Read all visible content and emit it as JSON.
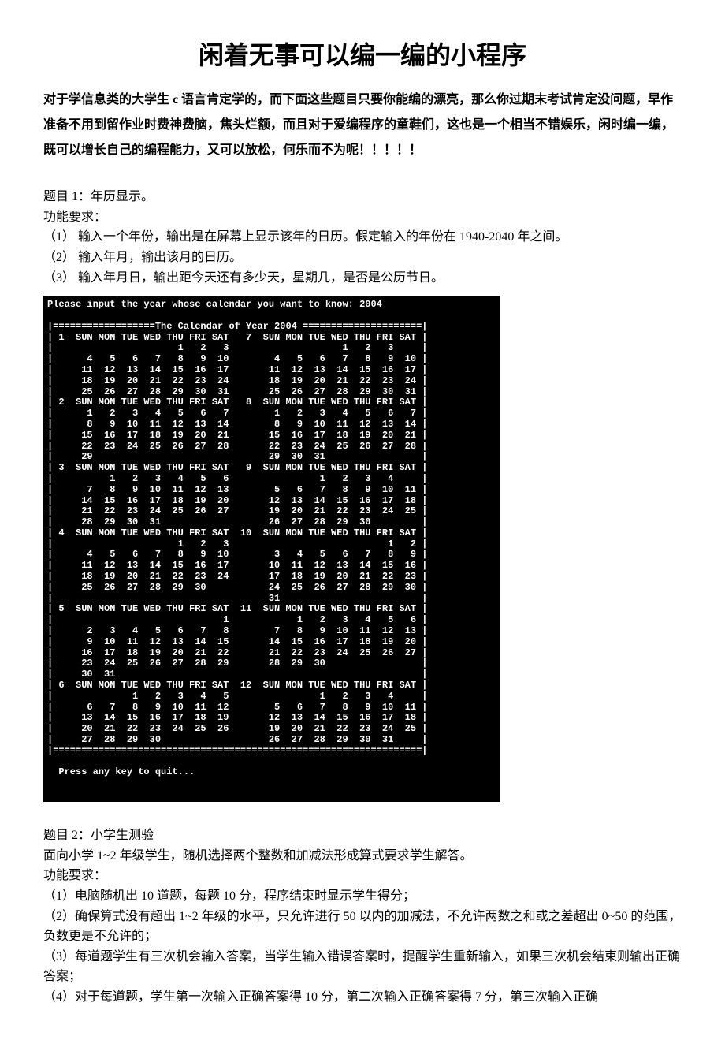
{
  "title": "闲着无事可以编一编的小程序",
  "intro": "对于学信息类的大学生 c 语言肯定学的，而下面这些题目只要你能编的漂亮，那么你过期末考试肯定没问题，早作准备不用到留作业时费神费脑，焦头烂额，而且对于爱编程序的童鞋们，这也是一个相当不错娱乐，闲时编一编，既可以增长自己的编程能力，又可以放松，何乐而不为呢！！！！！",
  "problem1": {
    "title": "题目 1：年历显示。",
    "req_label": "功能要求：",
    "items": [
      "（1）  输入一个年份，输出是在屏幕上显示该年的日历。假定输入的年份在 1940-2040 年之间。",
      "（2）  输入年月，输出该月的日历。",
      "（3）  输入年月日，输出距今天还有多少天，星期几，是否是公历节日。"
    ]
  },
  "console": "Please input the year whose calendar you want to know: 2004\n\n|==================The Calendar of Year 2004 =====================|\n| 1  SUN MON TUE WED THU FRI SAT   7  SUN MON TUE WED THU FRI SAT |\n|                      1   2   3                    1   2   3     |\n|      4   5   6   7   8   9  10        4   5   6   7   8   9  10 |\n|     11  12  13  14  15  16  17       11  12  13  14  15  16  17 |\n|     18  19  20  21  22  23  24       18  19  20  21  22  23  24 |\n|     25  26  27  28  29  30  31       25  26  27  28  29  30  31 |\n| 2  SUN MON TUE WED THU FRI SAT   8  SUN MON TUE WED THU FRI SAT |\n|      1   2   3   4   5   6   7        1   2   3   4   5   6   7 |\n|      8   9  10  11  12  13  14        8   9  10  11  12  13  14 |\n|     15  16  17  18  19  20  21       15  16  17  18  19  20  21 |\n|     22  23  24  25  26  27  28       22  23  24  25  26  27  28 |\n|     29                               29  30  31                 |\n| 3  SUN MON TUE WED THU FRI SAT   9  SUN MON TUE WED THU FRI SAT |\n|          1   2   3   4   5   6                1   2   3   4     |\n|      7   8   9  10  11  12  13        5   6   7   8   9  10  11 |\n|     14  15  16  17  18  19  20       12  13  14  15  16  17  18 |\n|     21  22  23  24  25  26  27       19  20  21  22  23  24  25 |\n|     28  29  30  31                   26  27  28  29  30         |\n| 4  SUN MON TUE WED THU FRI SAT  10  SUN MON TUE WED THU FRI SAT |\n|                      1   2   3                            1   2 |\n|      4   5   6   7   8   9  10        3   4   5   6   7   8   9 |\n|     11  12  13  14  15  16  17       10  11  12  13  14  15  16 |\n|     18  19  20  21  22  23  24       17  18  19  20  21  22  23 |\n|     25  26  27  28  29  30           24  25  26  27  28  29  30 |\n|                                      31                         |\n| 5  SUN MON TUE WED THU FRI SAT  11  SUN MON TUE WED THU FRI SAT |\n|                              1            1   2   3   4   5   6 |\n|      2   3   4   5   6   7   8        7   8   9  10  11  12  13 |\n|      9  10  11  12  13  14  15       14  15  16  17  18  19  20 |\n|     16  17  18  19  20  21  22       21  22  23  24  25  26  27 |\n|     23  24  25  26  27  28  29       28  29  30                 |\n|     30  31                                                      |\n| 6  SUN MON TUE WED THU FRI SAT  12  SUN MON TUE WED THU FRI SAT |\n|              1   2   3   4   5                1   2   3   4     |\n|      6   7   8   9  10  11  12        5   6   7   8   9  10  11 |\n|     13  14  15  16  17  18  19       12  13  14  15  16  17  18 |\n|     20  21  22  23  24  25  26       19  20  21  22  23  24  25 |\n|     27  28  29  30                   26  27  28  29  30  31     |\n|=================================================================|\n\n  Press any key to quit...",
  "problem2": {
    "title": "题目 2：小学生测验",
    "desc": "面向小学 1~2 年级学生，随机选择两个整数和加减法形成算式要求学生解答。",
    "req_label": "功能要求：",
    "items": [
      "（1）电脑随机出 10 道题，每题 10 分，程序结束时显示学生得分；",
      "（2）确保算式没有超出 1~2 年级的水平，只允许进行 50 以内的加减法，不允许两数之和或之差超出 0~50 的范围，负数更是不允许的；",
      "（3）每道题学生有三次机会输入答案，当学生输入错误答案时，提醒学生重新输入，如果三次机会结束则输出正确答案；",
      "（4）对于每道题，学生第一次输入正确答案得 10 分，第二次输入正确答案得 7 分，第三次输入正确"
    ]
  }
}
